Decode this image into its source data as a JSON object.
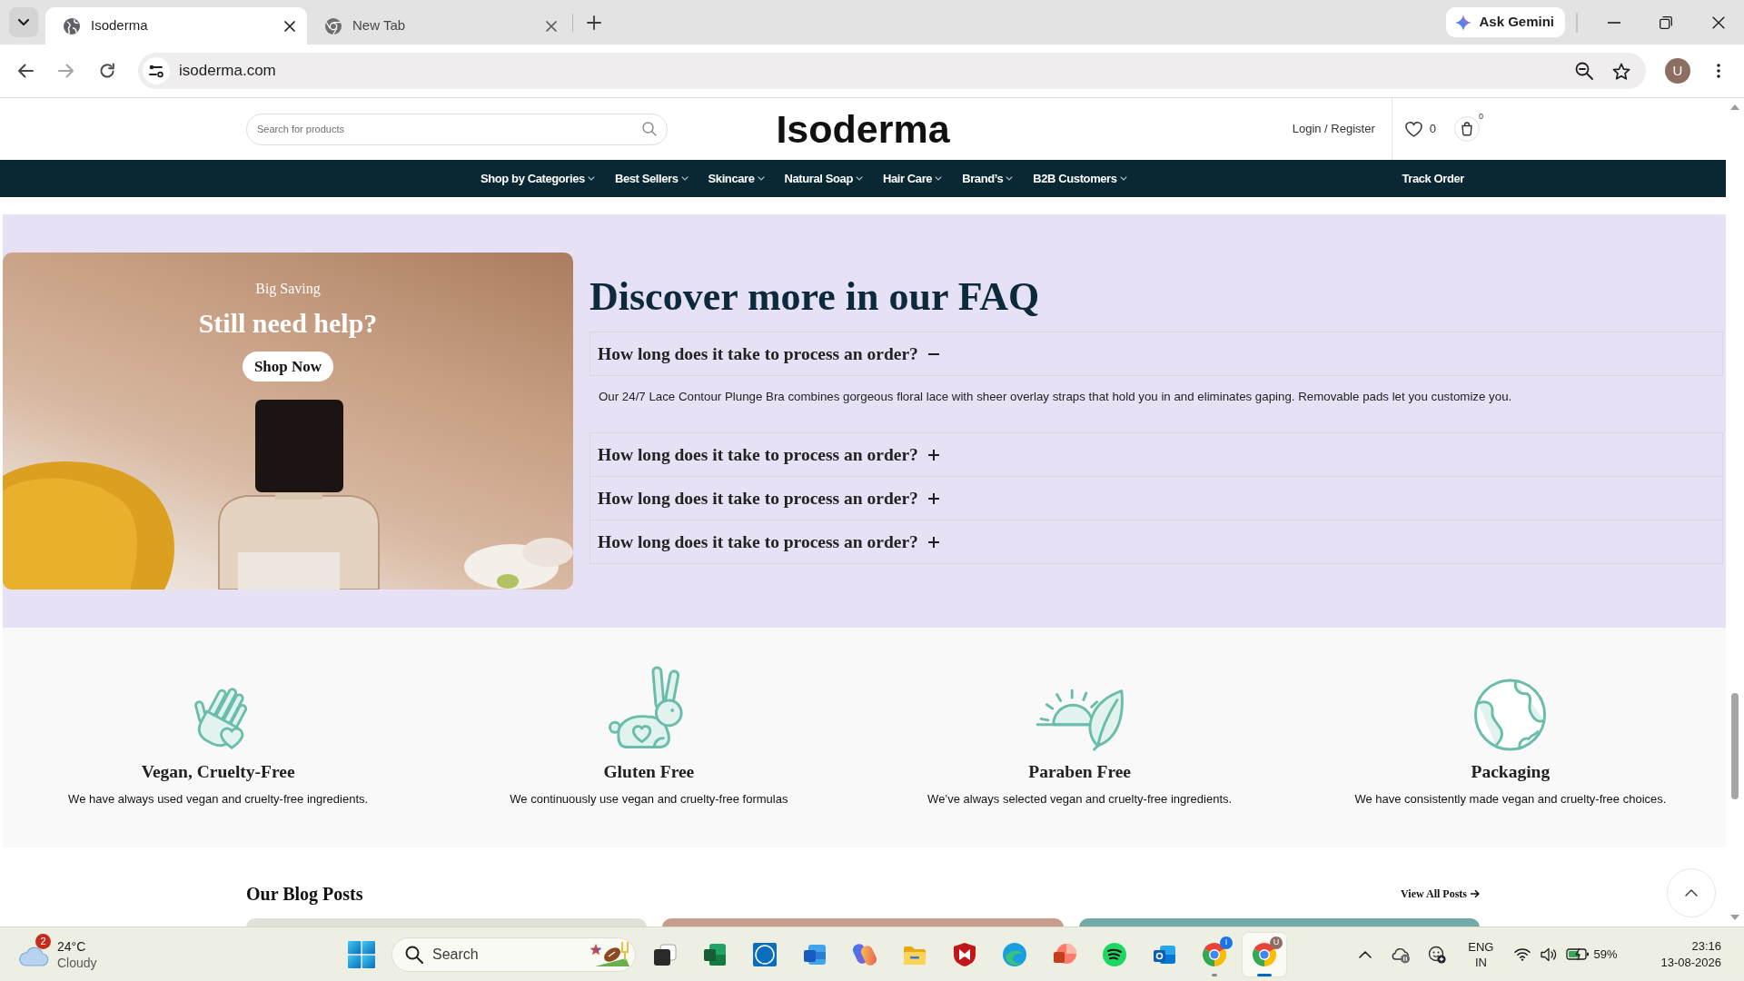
{
  "browser": {
    "tabs": [
      {
        "kind": "globe",
        "title": "Isoderma",
        "selected": true
      },
      {
        "kind": "chrome",
        "title": "New Tab",
        "selected": false
      }
    ],
    "ask_gemini": "Ask Gemini",
    "forward": {
      "disabled": true
    },
    "address": "isoderma.com",
    "profile_initial": "U"
  },
  "header": {
    "search": {
      "placeholder": "Search for products"
    },
    "logo": "Isoderma",
    "login": "Login / Register",
    "wishlist_count": "0",
    "cart_count": "0"
  },
  "nav": {
    "items": [
      {
        "label": "Shop by Categories",
        "dropdown": true
      },
      {
        "label": "Best Sellers",
        "dropdown": true
      },
      {
        "label": "Skincare",
        "dropdown": true
      },
      {
        "label": "Natural Soap",
        "dropdown": true
      },
      {
        "label": "Hair Care",
        "dropdown": true
      },
      {
        "label": "Brand’s",
        "dropdown": true
      },
      {
        "label": "B2B Customers",
        "dropdown": true
      }
    ],
    "track_order": "Track Order"
  },
  "promo": {
    "eyebrow": "Big Saving",
    "title": "Still need help?",
    "button": "Shop Now"
  },
  "faq": {
    "title": "Discover more in our FAQ",
    "items": [
      {
        "question": "How long does it take to process an order?",
        "expanded": true,
        "answer": "Our 24/7 Lace Contour Plunge Bra combines gorgeous floral lace with sheer overlay straps that hold you in and eliminates gaping. Removable pads let you customize you."
      },
      {
        "question": "How long does it take to process an order?",
        "expanded": false
      },
      {
        "question": "How long does it take to process an order?",
        "expanded": false
      },
      {
        "question": "How long does it take to process an order?",
        "expanded": false
      }
    ]
  },
  "features": [
    {
      "kind": "hand",
      "title": "Vegan, Cruelty-Free",
      "text": "We have always used vegan and cruelty-free ingredients."
    },
    {
      "kind": "rabbit",
      "title": "Gluten Free",
      "text": "We continuously use vegan and cruelty-free formulas"
    },
    {
      "kind": "sun",
      "title": "Paraben Free",
      "text": "We’ve always selected vegan and cruelty-free ingredients."
    },
    {
      "kind": "globe",
      "title": "Packaging",
      "text": "We have consistently made vegan and cruelty-free choices."
    }
  ],
  "blog": {
    "title": "Our Blog Posts",
    "view_all": "View All Posts"
  },
  "taskbar": {
    "weather": {
      "alerts": "2",
      "temperature": "24°C",
      "condition": "Cloudy"
    },
    "search": "Search",
    "apps": [
      {
        "kind": "taskview",
        "selected": false,
        "running": false
      },
      {
        "kind": "sheet",
        "selected": false,
        "running": false
      },
      {
        "kind": "ring",
        "selected": false,
        "running": false
      },
      {
        "kind": "doc",
        "selected": false,
        "running": false
      },
      {
        "kind": "swirl",
        "selected": false,
        "running": false
      },
      {
        "kind": "folder",
        "selected": false,
        "running": false
      },
      {
        "kind": "shield",
        "selected": false,
        "running": false
      },
      {
        "kind": "wave",
        "selected": false,
        "running": false
      },
      {
        "kind": "slides",
        "selected": false,
        "running": false
      },
      {
        "kind": "music",
        "selected": false,
        "running": false
      },
      {
        "kind": "mail",
        "selected": false,
        "running": false
      },
      {
        "kind": "browser",
        "selected": false,
        "running": true,
        "badge": "I",
        "color": "#1a73e8"
      },
      {
        "kind": "browser",
        "selected": true,
        "running": true,
        "badge": "U",
        "color": "#8d6e63"
      }
    ],
    "language": "ENG",
    "region": "IN",
    "battery": "59%",
    "time": "23:16",
    "date": "13-08-2026"
  }
}
